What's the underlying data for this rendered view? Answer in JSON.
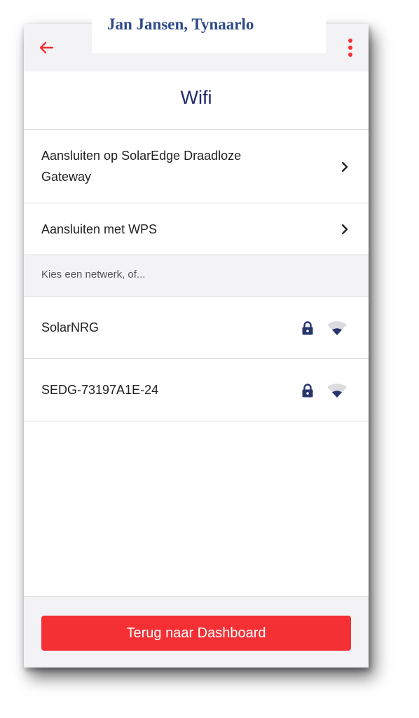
{
  "owner_banner": "Jan Jansen, Tynaarlo",
  "header": {
    "back_icon": "arrow-left-icon",
    "menu_icon": "more-vertical-icon",
    "title": "Wifi"
  },
  "options": [
    {
      "label": "Aansluiten op SolarEdge Draadloze Gateway",
      "icon": "chevron-right-icon"
    },
    {
      "label": "Aansluiten met WPS",
      "icon": "chevron-right-icon"
    }
  ],
  "networks_section": {
    "header": "Kies een netwerk, of...",
    "networks": [
      {
        "ssid": "SolarNRG",
        "secured": true,
        "lock_icon": "lock-icon",
        "signal_icon": "wifi-signal-icon"
      },
      {
        "ssid": "SEDG-73197A1E-24",
        "secured": true,
        "lock_icon": "lock-icon",
        "signal_icon": "wifi-signal-icon"
      }
    ]
  },
  "footer": {
    "button_label": "Terug naar Dashboard"
  },
  "colors": {
    "accent_red": "#f43035",
    "title_navy": "#1f2a6b",
    "icon_navy": "#27356f",
    "signal_grey": "#dcdce0",
    "banner_blue": "#2d4a8a"
  }
}
